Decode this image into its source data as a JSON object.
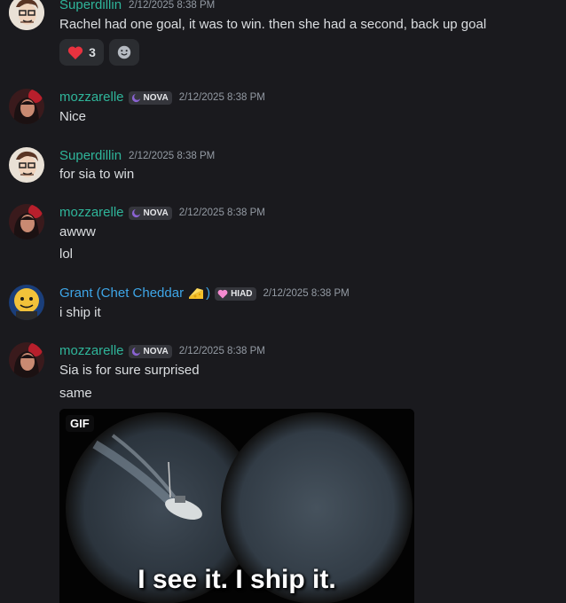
{
  "messages": [
    {
      "author": "Superdillin",
      "author_color": "#2fb59a",
      "timestamp": "2/12/2025 8:38 PM",
      "lines": [
        "Rachel had one goal, it was to win. then she had a second, back up goal"
      ],
      "reactions": [
        {
          "emoji": "heart-icon",
          "count": "3"
        },
        {
          "emoji": "add-reaction-icon"
        }
      ]
    },
    {
      "author": "mozzarelle",
      "author_color": "#2fb59a",
      "tag": "NOVA",
      "timestamp": "2/12/2025 8:38 PM",
      "lines": [
        "Nice"
      ]
    },
    {
      "author": "Superdillin",
      "author_color": "#2fb59a",
      "timestamp": "2/12/2025 8:38 PM",
      "lines": [
        "for sia to win"
      ]
    },
    {
      "author": "mozzarelle",
      "author_color": "#2fb59a",
      "tag": "NOVA",
      "timestamp": "2/12/2025 8:38 PM",
      "lines": [
        "awww",
        "lol"
      ]
    },
    {
      "author": "Grant (Chet Cheddar",
      "author_suffix": ")",
      "author_color": "#3ea6e8",
      "tag": "HIAD",
      "timestamp": "2/12/2025 8:38 PM",
      "lines": [
        "i ship it"
      ]
    },
    {
      "author": "mozzarelle",
      "author_color": "#2fb59a",
      "tag": "NOVA",
      "timestamp": "2/12/2025 8:38 PM",
      "lines": [
        "Sia is for sure surprised",
        "same"
      ],
      "gif": {
        "badge": "GIF",
        "caption": "I see it. I ship it."
      }
    }
  ]
}
